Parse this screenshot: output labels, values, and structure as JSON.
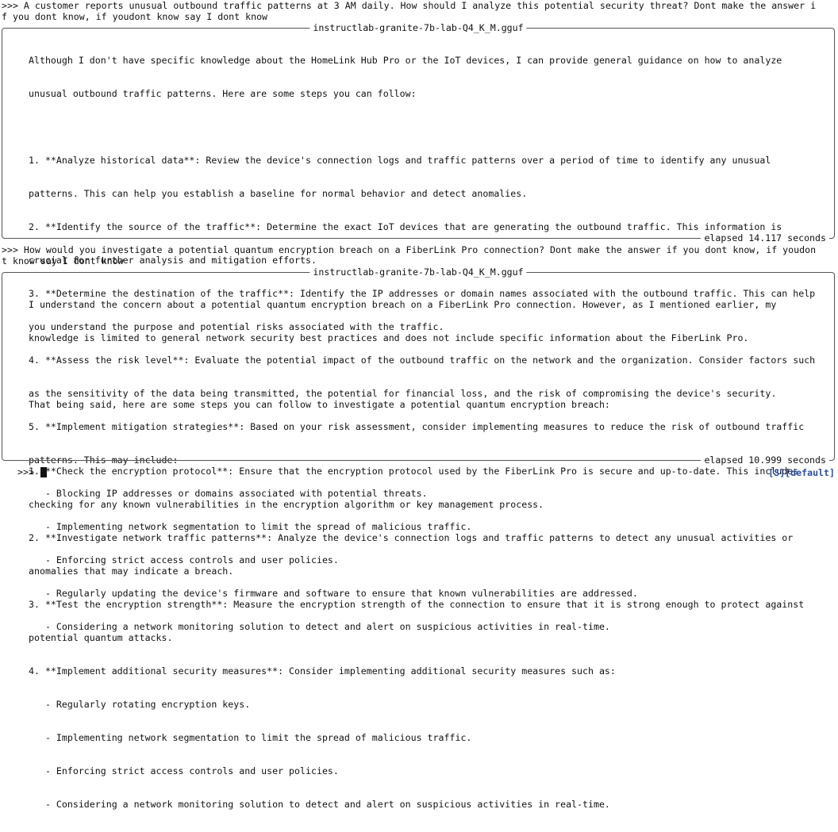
{
  "exchanges": [
    {
      "question_lines": [
        ">>> A customer reports unusual outbound traffic patterns at 3 AM daily. How should I analyze this potential security threat? Dont make the answer i",
        "f you dont know, if youdont know say I dont know"
      ],
      "model": "instructlab-granite-7b-lab-Q4_K_M.gguf",
      "answer_lines": [
        "Although I don't have specific knowledge about the HomeLink Hub Pro or the IoT devices, I can provide general guidance on how to analyze",
        "unusual outbound traffic patterns. Here are some steps you can follow:",
        "",
        "1. **Analyze historical data**: Review the device's connection logs and traffic patterns over a period of time to identify any unusual",
        "patterns. This can help you establish a baseline for normal behavior and detect anomalies.",
        "2. **Identify the source of the traffic**: Determine the exact IoT devices that are generating the outbound traffic. This information is",
        "crucial for further analysis and mitigation efforts.",
        "3. **Determine the destination of the traffic**: Identify the IP addresses or domain names associated with the outbound traffic. This can help",
        "you understand the purpose and potential risks associated with the traffic.",
        "4. **Assess the risk level**: Evaluate the potential impact of the outbound traffic on the network and the organization. Consider factors such",
        "as the sensitivity of the data being transmitted, the potential for financial loss, and the risk of compromising the device's security.",
        "5. **Implement mitigation strategies**: Based on your risk assessment, consider implementing measures to reduce the risk of outbound traffic",
        "patterns. This may include:",
        "   - Blocking IP addresses or domains associated with potential threats.",
        "   - Implementing network segmentation to limit the spread of malicious traffic.",
        "   - Enforcing strict access controls and user policies.",
        "   - Regularly updating the device's firmware and software to ensure that known vulnerabilities are addressed.",
        "   - Considering a network monitoring solution to detect and alert on suspicious activities in real-time."
      ],
      "elapsed": "elapsed 14.117 seconds"
    },
    {
      "question_lines": [
        ">>> How would you investigate a potential quantum encryption breach on a FiberLink Pro connection? Dont make the answer if you dont know, if youdon",
        "t know say I dont know"
      ],
      "model": "instructlab-granite-7b-lab-Q4_K_M.gguf",
      "answer_lines": [
        "I understand the concern about a potential quantum encryption breach on a FiberLink Pro connection. However, as I mentioned earlier, my",
        "knowledge is limited to general network security best practices and does not include specific information about the FiberLink Pro.",
        "",
        "That being said, here are some steps you can follow to investigate a potential quantum encryption breach:",
        "",
        "1. **Check the encryption protocol**: Ensure that the encryption protocol used by the FiberLink Pro is secure and up-to-date. This includes",
        "checking for any known vulnerabilities in the encryption algorithm or key management process.",
        "2. **Investigate network traffic patterns**: Analyze the device's connection logs and traffic patterns to detect any unusual activities or",
        "anomalies that may indicate a breach.",
        "3. **Test the encryption strength**: Measure the encryption strength of the connection to ensure that it is strong enough to protect against",
        "potential quantum attacks.",
        "4. **Implement additional security measures**: Consider implementing additional security measures such as:",
        "   - Regularly rotating encryption keys.",
        "   - Implementing network segmentation to limit the spread of malicious traffic.",
        "   - Enforcing strict access controls and user policies.",
        "   - Considering a network monitoring solution to detect and alert on suspicious activities in real-time."
      ],
      "elapsed": "elapsed 10.999 seconds"
    }
  ],
  "prompt": ">>>",
  "status": "[S][default]"
}
